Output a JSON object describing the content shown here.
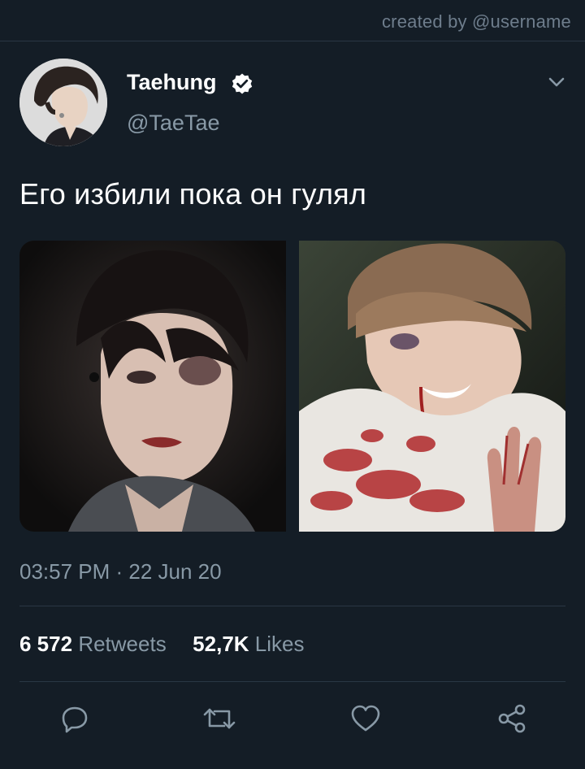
{
  "watermark": "created by @username",
  "author": {
    "display_name": "Taehung",
    "handle": "@TaeTae",
    "verified": true
  },
  "tweet": {
    "text": "Его избили пока он гулял",
    "timestamp": "03:57 PM · 22 Jun 20"
  },
  "stats": {
    "retweets_count": "6 572",
    "retweets_label": "Retweets",
    "likes_count": "52,7K",
    "likes_label": "Likes"
  },
  "actions": [
    "reply-icon",
    "retweet-icon",
    "like-icon",
    "share-icon"
  ],
  "colors": {
    "background": "#141d26",
    "secondary_text": "#8899a6",
    "divider": "#2a3744"
  }
}
